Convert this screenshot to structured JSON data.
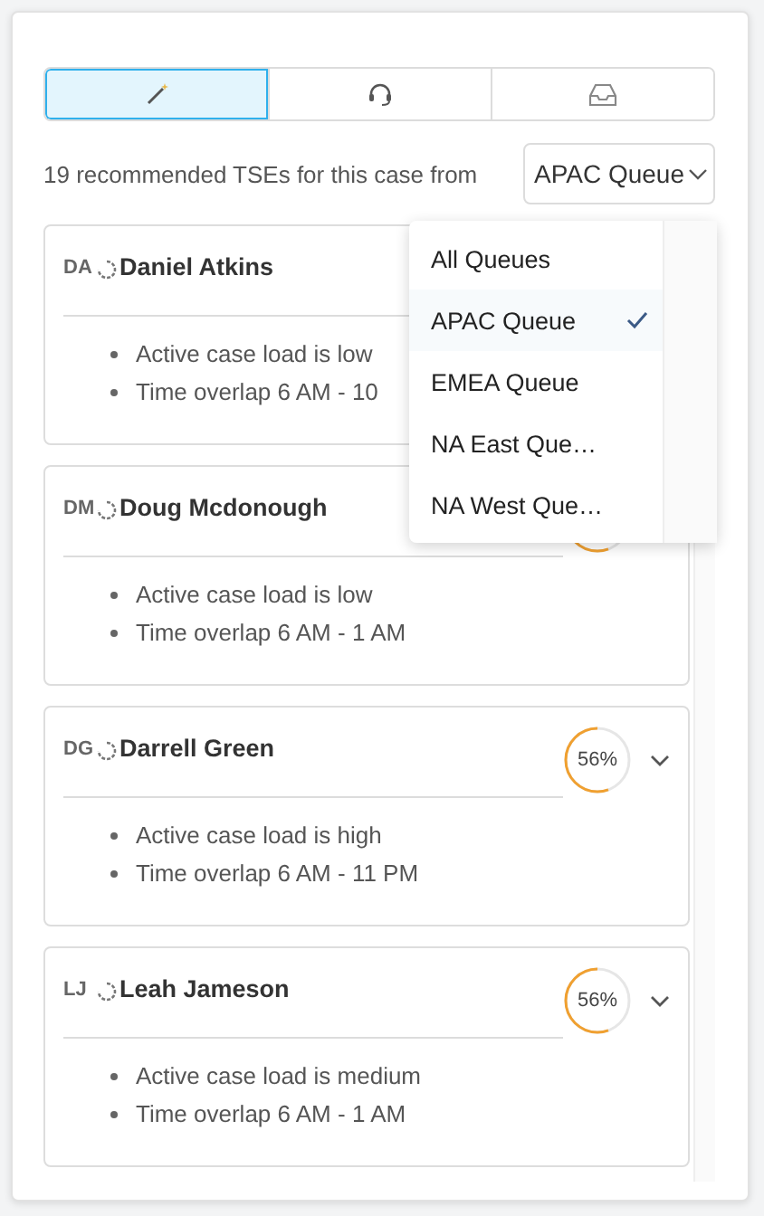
{
  "tabs": [
    {
      "selected": true
    },
    {
      "selected": false
    },
    {
      "selected": false
    }
  ],
  "summary": "19 recommended TSEs for this case from",
  "queue_select": {
    "value": "APAC Queue",
    "expanded": true
  },
  "queue_menu": [
    {
      "label": "All Queues",
      "selected": false
    },
    {
      "label": "APAC Queue",
      "selected": true
    },
    {
      "label": "EMEA Queue",
      "selected": false
    },
    {
      "label": "NA East Que…",
      "selected": false
    },
    {
      "label": "NA West Que…",
      "selected": false
    }
  ],
  "engineers": [
    {
      "initials": "DA",
      "name": "Daniel Atkins",
      "reasons": [
        "Active case load is low",
        "Time overlap 6 AM - 10"
      ]
    },
    {
      "initials": "DM",
      "name": "Doug Mcdonough",
      "ring": true,
      "reasons": [
        "Active case load is low",
        "Time overlap 6 AM - 1 AM"
      ]
    },
    {
      "initials": "DG",
      "name": "Darrell Green",
      "ring": true,
      "match": "56%",
      "reasons": [
        "Active case load is high",
        "Time overlap 6 AM - 11 PM"
      ]
    },
    {
      "initials": "LJ",
      "name": "Leah Jameson",
      "ring": true,
      "match": "56%",
      "reasons": [
        "Active case load is medium",
        "Time overlap 6 AM - 1 AM"
      ]
    }
  ]
}
